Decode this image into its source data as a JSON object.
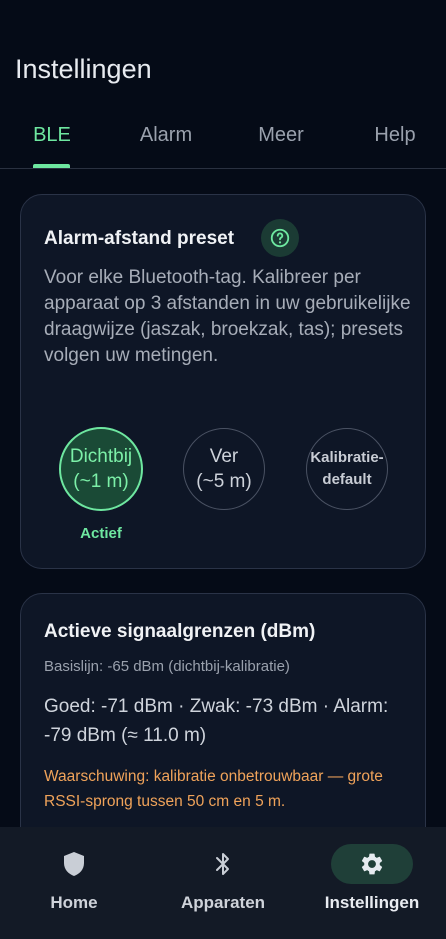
{
  "page": {
    "title": "Instellingen"
  },
  "tabs": [
    {
      "label": "BLE",
      "active": true
    },
    {
      "label": "Alarm",
      "active": false
    },
    {
      "label": "Meer",
      "active": false
    },
    {
      "label": "Help",
      "active": false
    }
  ],
  "preset_card": {
    "title": "Alarm-afstand preset",
    "help_icon": "question-circle-icon",
    "description": "Voor elke Bluetooth-tag. Kalibreer per apparaat op 3 afstanden in uw gebruikelijke draagwijze (jaszak, broekzak, tas); presets volgen uw metingen.",
    "presets": [
      {
        "label": "Dichtbij\n(~1 m)",
        "active": true
      },
      {
        "label": "Ver\n(~5 m)",
        "active": false
      },
      {
        "label": "Kalibratie-\ndefault",
        "active": false
      }
    ],
    "active_caption": "Actief"
  },
  "signal_card": {
    "title": "Actieve signaalgrenzen (dBm)",
    "baseline": "Basislijn: -65 dBm (dichtbij-kalibratie)",
    "limits": "Goed: -71 dBm · Zwak: -73 dBm · Alarm: -79 dBm (≈ 11.0 m)",
    "warning": "Waarschuwing: kalibratie onbetrouwbaar — grote RSSI-sprong tussen 50 cm en 5 m."
  },
  "bottom_nav": [
    {
      "label": "Home",
      "icon": "shield-icon",
      "active": false
    },
    {
      "label": "Apparaten",
      "icon": "bluetooth-icon",
      "active": false
    },
    {
      "label": "Instellingen",
      "icon": "gear-icon",
      "active": true
    }
  ],
  "colors": {
    "accent": "#6ee7a0",
    "background": "#050b17",
    "card": "#0e1626",
    "warning": "#f0a35a"
  }
}
